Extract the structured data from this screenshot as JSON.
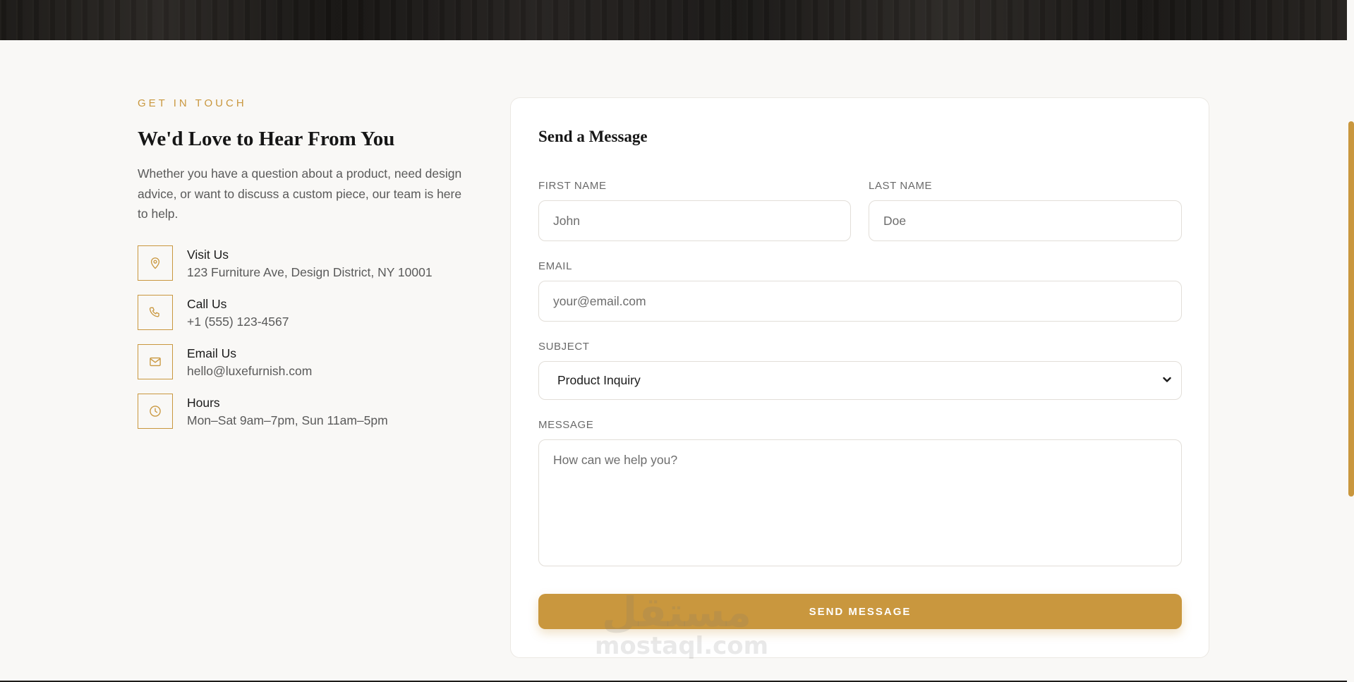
{
  "contact_info": {
    "eyebrow": "GET IN TOUCH",
    "title": "We'd Love to Hear From You",
    "description": "Whether you have a question about a product, need design advice, or want to discuss a custom piece, our team is here to help.",
    "items": [
      {
        "icon": "map-pin-icon",
        "label": "Visit Us",
        "value": "123 Furniture Ave, Design District, NY 10001"
      },
      {
        "icon": "phone-icon",
        "label": "Call Us",
        "value": "+1 (555) 123-4567"
      },
      {
        "icon": "mail-icon",
        "label": "Email Us",
        "value": "hello@luxefurnish.com"
      },
      {
        "icon": "clock-icon",
        "label": "Hours",
        "value": "Mon–Sat 9am–7pm, Sun 11am–5pm"
      }
    ]
  },
  "form": {
    "title": "Send a Message",
    "first_name": {
      "label": "FIRST NAME",
      "placeholder": "John"
    },
    "last_name": {
      "label": "LAST NAME",
      "placeholder": "Doe"
    },
    "email": {
      "label": "EMAIL",
      "placeholder": "your@email.com"
    },
    "subject": {
      "label": "SUBJECT",
      "value": "Product Inquiry"
    },
    "message": {
      "label": "MESSAGE",
      "placeholder": "How can we help you?"
    },
    "submit_label": "SEND MESSAGE"
  },
  "watermark": {
    "arabic": "مستقل",
    "latin": "mostaql.com"
  },
  "colors": {
    "accent": "#c9973e",
    "background": "#f9f8f6",
    "card": "#ffffff",
    "text": "#1b1b1b",
    "muted": "#5a5a5a"
  }
}
